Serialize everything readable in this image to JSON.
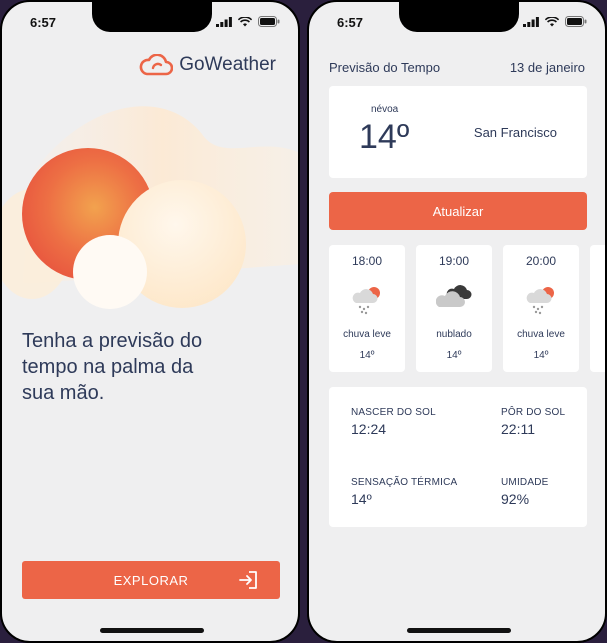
{
  "status": {
    "time": "6:57"
  },
  "welcome": {
    "logo_text": "GoWeather",
    "headline": "Tenha a previsão do tempo na palma da sua mão.",
    "explore_label": "EXPLORAR",
    "icons": {
      "logo": "cloud-logo-icon",
      "explore": "enter-arrow-icon"
    }
  },
  "forecast": {
    "title": "Previsão do Tempo",
    "date": "13 de janeiro",
    "current": {
      "condition": "névoa",
      "temperature": "14º",
      "city": "San Francisco"
    },
    "refresh_label": "Atualizar",
    "hourly": [
      {
        "time": "18:00",
        "icon": "light-rain-icon",
        "condition": "chuva leve",
        "temp": "14º"
      },
      {
        "time": "19:00",
        "icon": "cloudy-icon",
        "condition": "nublado",
        "temp": "14º"
      },
      {
        "time": "20:00",
        "icon": "light-rain-icon",
        "condition": "chuva leve",
        "temp": "14º"
      }
    ],
    "details": {
      "sunrise_label": "NASCER DO SOL",
      "sunrise_value": "12:24",
      "sunset_label": "PÔR DO SOL",
      "sunset_value": "22:11",
      "feels_label": "SENSAÇÃO TÉRMICA",
      "feels_value": "14º",
      "humidity_label": "UMIDADE",
      "humidity_value": "92%"
    }
  },
  "colors": {
    "accent": "#ec6547",
    "text": "#2e3a59",
    "background": "#efeff0"
  }
}
